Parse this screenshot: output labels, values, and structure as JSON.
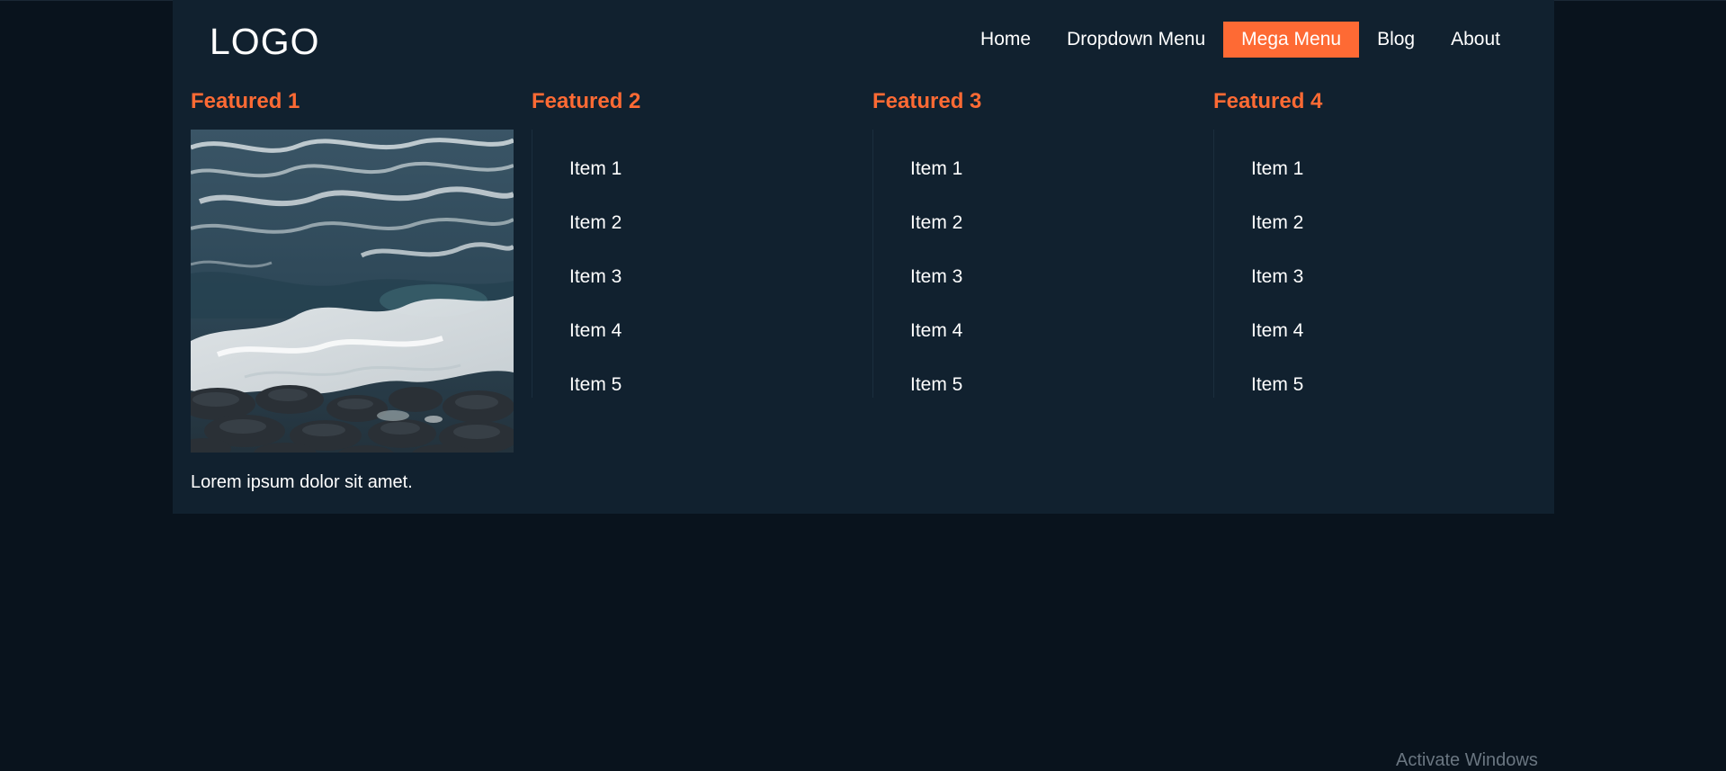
{
  "header": {
    "logo": "LOGO",
    "nav": [
      {
        "label": "Home",
        "active": false
      },
      {
        "label": "Dropdown Menu",
        "active": false
      },
      {
        "label": "Mega Menu",
        "active": true
      },
      {
        "label": "Blog",
        "active": false
      },
      {
        "label": "About",
        "active": false
      }
    ]
  },
  "mega_menu": {
    "columns": [
      {
        "title": "Featured 1",
        "image": "ocean-waves-on-rocks",
        "text": "Lorem ipsum dolor sit amet."
      },
      {
        "title": "Featured 2",
        "items": [
          "Item 1",
          "Item 2",
          "Item 3",
          "Item 4",
          "Item 5"
        ]
      },
      {
        "title": "Featured 3",
        "items": [
          "Item 1",
          "Item 2",
          "Item 3",
          "Item 4",
          "Item 5"
        ]
      },
      {
        "title": "Featured 4",
        "items": [
          "Item 1",
          "Item 2",
          "Item 3",
          "Item 4",
          "Item 5"
        ]
      }
    ]
  },
  "overlay": {
    "corner_text": "Activate Windows"
  },
  "colors": {
    "page_background": "#09131d",
    "panel_background": "#11212f",
    "accent": "#fe6a34",
    "text": "#ffffff"
  }
}
